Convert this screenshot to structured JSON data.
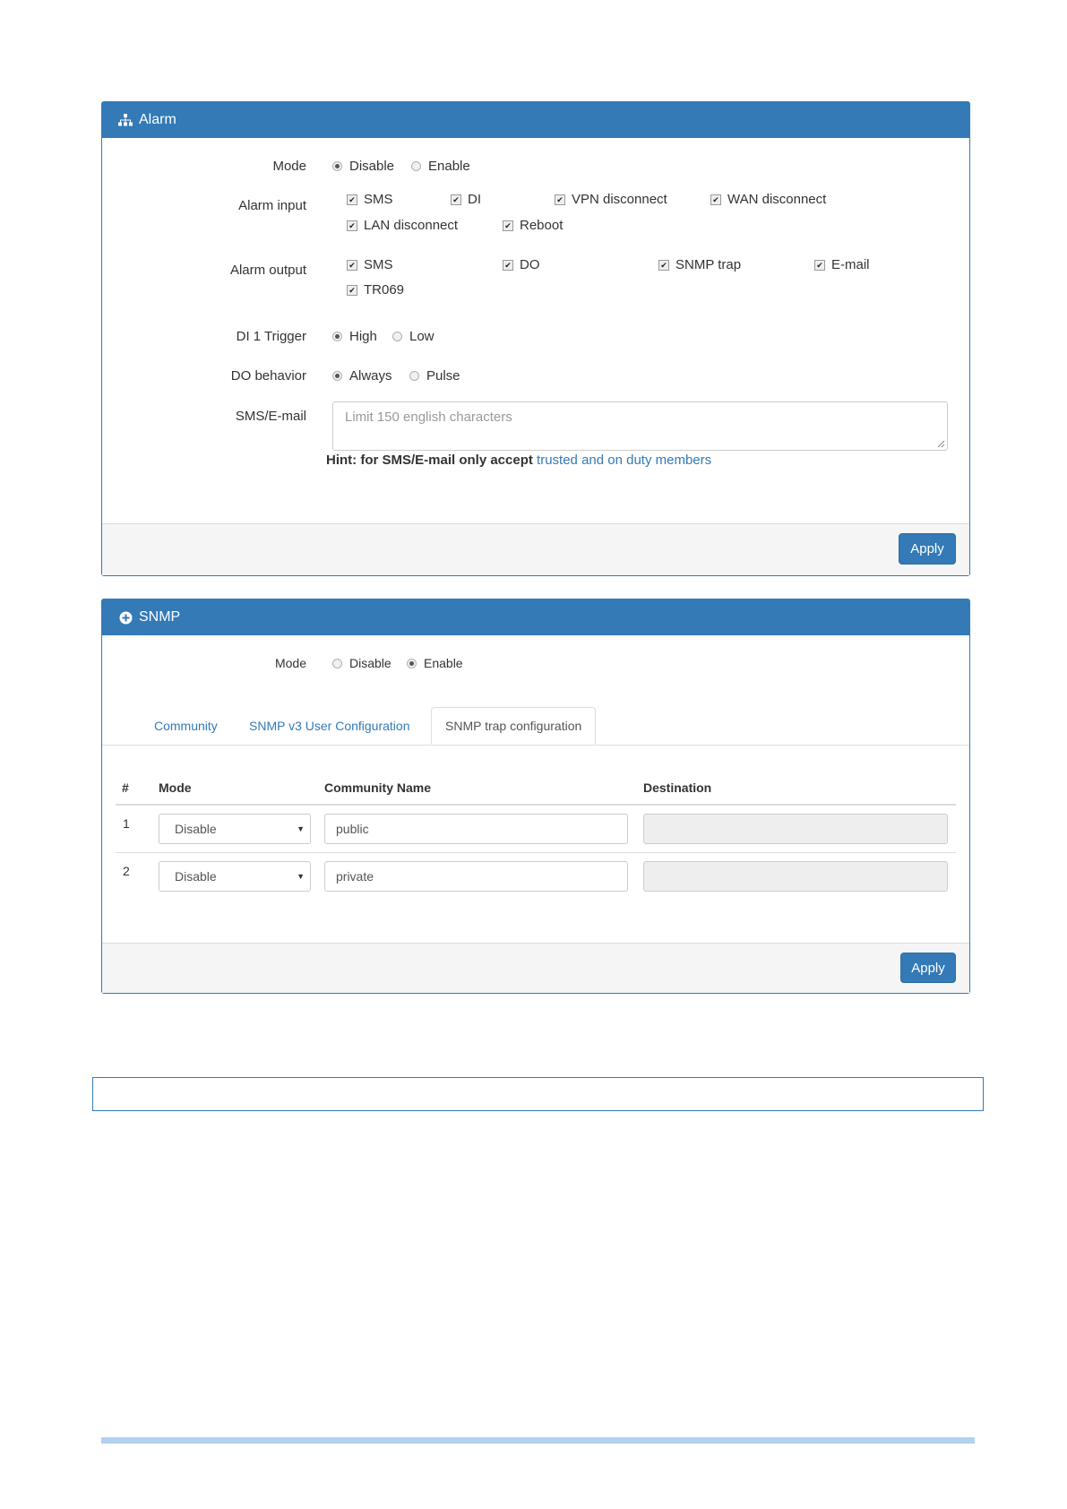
{
  "alarm": {
    "title": "Alarm",
    "mode": {
      "label": "Mode",
      "options": [
        "Disable",
        "Enable"
      ],
      "selected": "Disable"
    },
    "alarm_input": {
      "label": "Alarm input",
      "options": [
        "SMS",
        "DI",
        "VPN disconnect",
        "WAN disconnect",
        "LAN disconnect",
        "Reboot"
      ]
    },
    "alarm_output": {
      "label": "Alarm output",
      "options": [
        "SMS",
        "DO",
        "SNMP trap",
        "E-mail",
        "TR069"
      ]
    },
    "di_trigger": {
      "label": "DI 1 Trigger",
      "options": [
        "High",
        "Low"
      ],
      "selected": "High"
    },
    "do_behavior": {
      "label": "DO behavior",
      "options": [
        "Always",
        "Pulse"
      ],
      "selected": "Always"
    },
    "sms_email": {
      "label": "SMS/E-mail",
      "placeholder": "Limit 150 english characters"
    },
    "hint": {
      "prefix": "Hint: for SMS/E-mail only accept",
      "link": "trusted and on duty members"
    },
    "apply_label": "Apply"
  },
  "snmp": {
    "title": "SNMP",
    "mode": {
      "label": "Mode",
      "options": [
        "Disable",
        "Enable"
      ],
      "selected": "Enable"
    },
    "tabs": [
      {
        "label": "Community"
      },
      {
        "label": "SNMP v3 User Configuration"
      },
      {
        "label": "SNMP trap configuration"
      }
    ],
    "active_tab": "SNMP trap configuration",
    "table": {
      "headers": [
        "#",
        "Mode",
        "Community Name",
        "Destination"
      ],
      "rows": [
        {
          "num": "1",
          "mode": "Disable",
          "community": "public",
          "destination": ""
        },
        {
          "num": "2",
          "mode": "Disable",
          "community": "private",
          "destination": ""
        }
      ]
    },
    "apply_label": "Apply"
  },
  "colors": {
    "primary": "#337ab7",
    "footer_bg": "#f5f5f5",
    "bottom_bar": "#b3cff2"
  },
  "icons": {
    "alarm": "sitemap-icon",
    "snmp": "plus-circle-icon"
  }
}
